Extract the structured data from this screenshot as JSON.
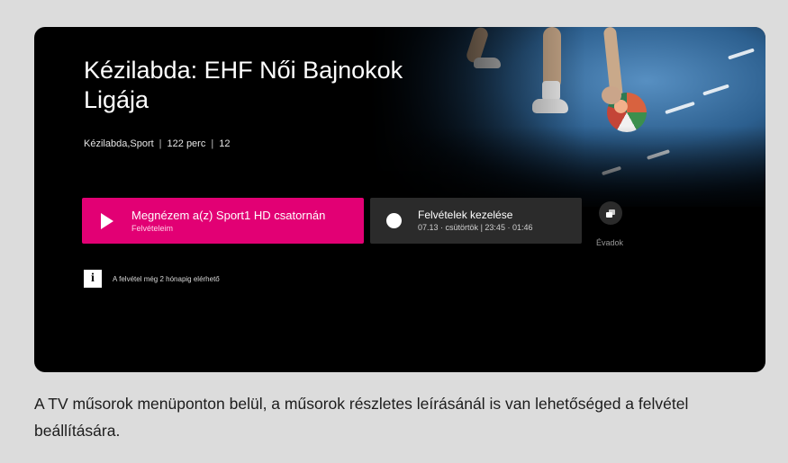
{
  "program": {
    "title": "Kézilabda: EHF Női Bajnokok Ligája",
    "genre": "Kézilabda,Sport",
    "duration": "122 perc",
    "age_rating": "12",
    "separator": "|"
  },
  "actions": {
    "primary": {
      "label": "Megnézem a(z) Sport1 HD csatornán",
      "sublabel": "Felvételeim",
      "icon": "play-icon"
    },
    "secondary": {
      "label": "Felvételek kezelése",
      "date": "07.13 · csütörtök",
      "time": "23:45 · 01:46",
      "icon": "record-icon"
    },
    "seasons": {
      "label": "Évadok",
      "icon": "seasons-icon"
    }
  },
  "info": {
    "icon_glyph": "i",
    "text": "A felvétel még 2 hónapig elérhető"
  },
  "caption": "A TV műsorok menüponton belül, a műsorok részletes leírásánál is van lehetőséged a felvétel beállítására.",
  "colors": {
    "accent": "#e20074",
    "background": "#000000",
    "secondary_button": "#2b2b2b",
    "page_background": "#dcdcdc"
  }
}
